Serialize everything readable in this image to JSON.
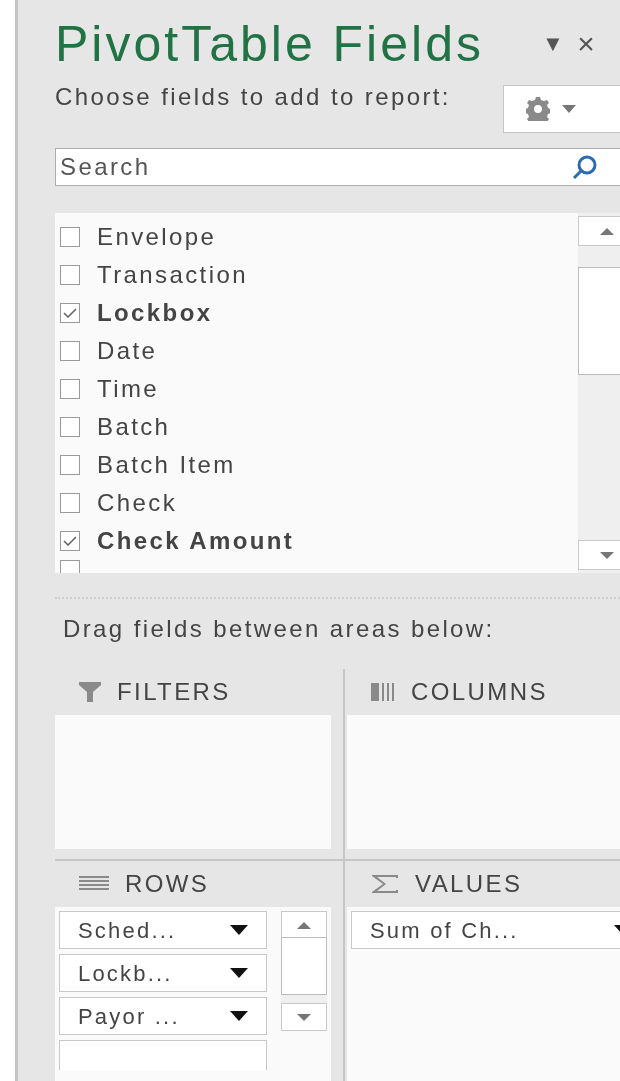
{
  "pane": {
    "title": "PivotTable Fields",
    "title_menu": "▼",
    "close": "×",
    "subtitle": "Choose fields to add to report:"
  },
  "search": {
    "placeholder": "Search"
  },
  "fields": [
    {
      "label": "Envelope",
      "checked": false
    },
    {
      "label": "Transaction",
      "checked": false
    },
    {
      "label": "Lockbox",
      "checked": true
    },
    {
      "label": "Date",
      "checked": false
    },
    {
      "label": "Time",
      "checked": false
    },
    {
      "label": "Batch",
      "checked": false
    },
    {
      "label": "Batch Item",
      "checked": false
    },
    {
      "label": "Check",
      "checked": false
    },
    {
      "label": "Check Amount",
      "checked": true
    }
  ],
  "partial_field": {
    "checked": false
  },
  "areas_hint": "Drag fields between areas below:",
  "areas": [
    {
      "kind": "filters",
      "title": "FILTERS"
    },
    {
      "kind": "columns",
      "title": "COLUMNS"
    },
    {
      "kind": "rows",
      "title": "ROWS",
      "items": [
        "Sched...",
        "Lockb...",
        "Payor ..."
      ]
    },
    {
      "kind": "values",
      "title": "VALUES",
      "items": [
        "Sum of Ch..."
      ]
    }
  ]
}
